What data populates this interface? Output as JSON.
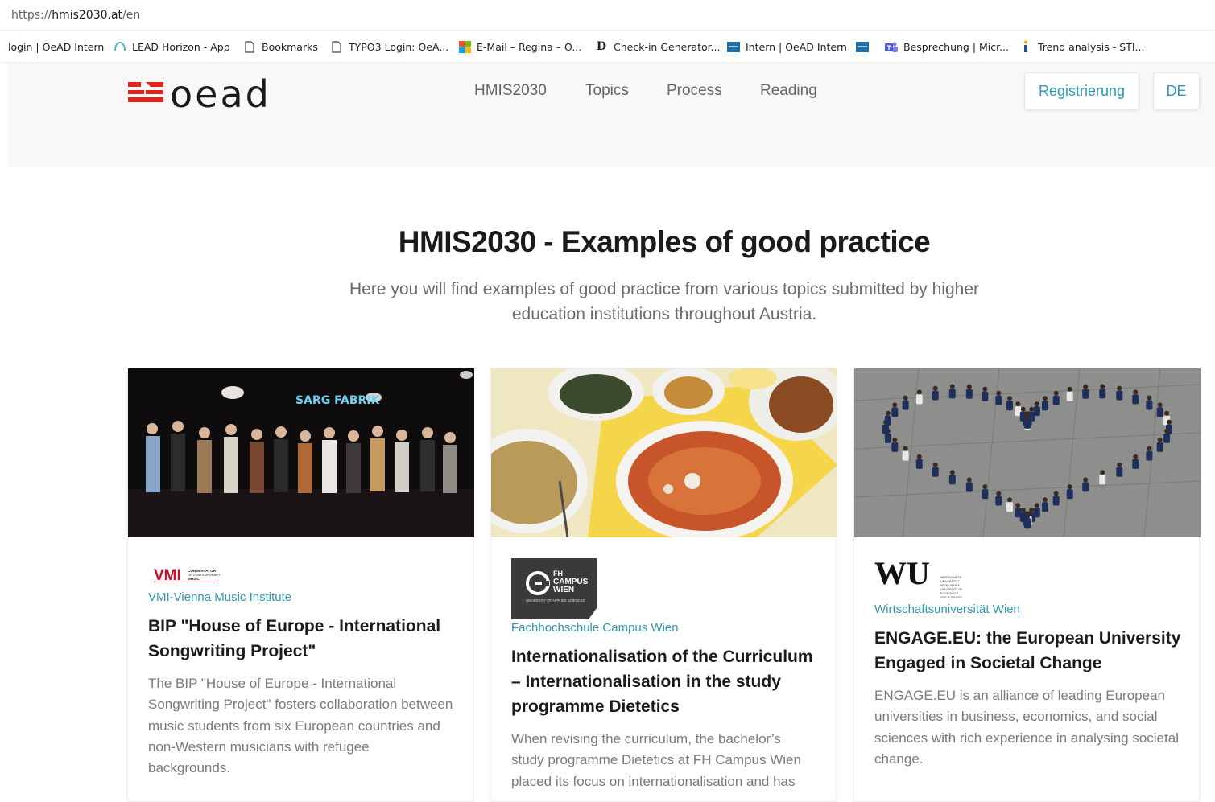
{
  "browser": {
    "url_scheme": "https://",
    "url_host": "hmis2030.at",
    "url_path": "/en",
    "bookmarks": [
      {
        "label": "login | OeAD Intern",
        "icon": "none"
      },
      {
        "label": "LEAD Horizon - App",
        "icon": "lead-icon"
      },
      {
        "label": "Bookmarks",
        "icon": "page-icon"
      },
      {
        "label": "TYPO3 Login: OeA...",
        "icon": "page-icon"
      },
      {
        "label": "E-Mail – Regina – O...",
        "icon": "microsoft-icon"
      },
      {
        "label": "Check-in Generator...",
        "icon": "d-icon"
      },
      {
        "label": "Intern | OeAD Intern",
        "icon": "oead-icon"
      },
      {
        "label": "",
        "icon": "oead-icon"
      },
      {
        "label": "Besprechung | Micr...",
        "icon": "teams-icon"
      },
      {
        "label": "Trend analysis - STI...",
        "icon": "info-icon"
      }
    ]
  },
  "header": {
    "logo_text": "oead",
    "nav": [
      "HMIS2030",
      "Topics",
      "Process",
      "Reading"
    ],
    "register_label": "Registrierung",
    "lang_label": "DE"
  },
  "main": {
    "title": "HMIS2030 - Examples of good practice",
    "subtitle": "Here you will find examples of good practice from various topics submitted by higher education institutions throughout Austria."
  },
  "cards": [
    {
      "institution": "VMI-Vienna Music Institute",
      "logo": "VMI",
      "logo_caption": "CONSERVATORY OF CONTEMPORARY MUSIC",
      "image": "concert-stage-photo",
      "image_sign": "SARG FABRIK",
      "title": "BIP \"House of Europe - International Songwriting Project\"",
      "description": "The BIP \"House of Europe - International Songwriting Project\" fosters collaboration between music students from six European countries and non-Western musicians with refugee backgrounds."
    },
    {
      "institution": "Fachhochschule Campus Wien",
      "logo": "FH CAMPUS WIEN",
      "logo_caption": "UNIVERSITY OF APPLIED SCIENCES",
      "image": "food-table-photo",
      "title": "Internationalisation of the Curriculum – Internationalisation in the study programme Dietetics",
      "description": "When revising the curriculum, the bachelor’s study programme Dietetics at FH Campus Wien placed its focus on internationalisation and has"
    },
    {
      "institution": "Wirtschaftsuniversität Wien",
      "logo": "WU",
      "image": "group-heart-photo",
      "title": "ENGAGE.EU: the European University Engaged in Societal Change",
      "description": "ENGAGE.EU is an alliance of leading European universities in business, economics, and social sciences with rich experience in analysing societal change."
    }
  ],
  "colors": {
    "accent": "#2f9bb3",
    "logo_red": "#e2231a",
    "logo_dark": "#1a1a1a",
    "header_bg": "#f8f8f8"
  }
}
